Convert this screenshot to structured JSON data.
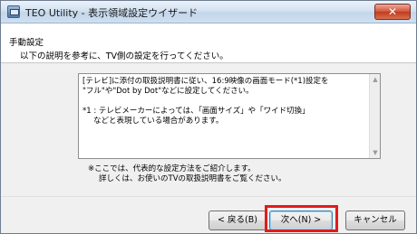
{
  "window": {
    "title": "TEO Utility - 表示領域設定ウイザード",
    "close_label": "✕"
  },
  "header": {
    "title": "手動設定",
    "description": "以下の説明を参考に、TV側の設定を行ってください。"
  },
  "instructions": {
    "line1": "[テレビ]に添付の取扱説明書に従い、16:9映像の画面モード(*1)設定を",
    "line2": "\"フル\"や\"Dot by Dot\"などに設定してください。",
    "note_line1": "*1 : テレビメーカーによっては、「画面サイズ」や「ワイド切換」",
    "note_line2": "などと表現している場合があります。"
  },
  "footnote": {
    "line1": "※ここでは、代表的な設定方法をご紹介します。",
    "line2": "詳しくは、お使いのTVの取扱説明書をご覧ください。"
  },
  "buttons": {
    "back": "< 戻る(B)",
    "next": "次へ(N) >",
    "cancel": "キャンセル"
  },
  "colors": {
    "highlight": "#e21b1b",
    "close_button": "#c03b1f"
  },
  "icons": {
    "app": "app-icon",
    "scroll_up": "scroll-up-arrow-icon",
    "scroll_down": "scroll-down-arrow-icon"
  }
}
